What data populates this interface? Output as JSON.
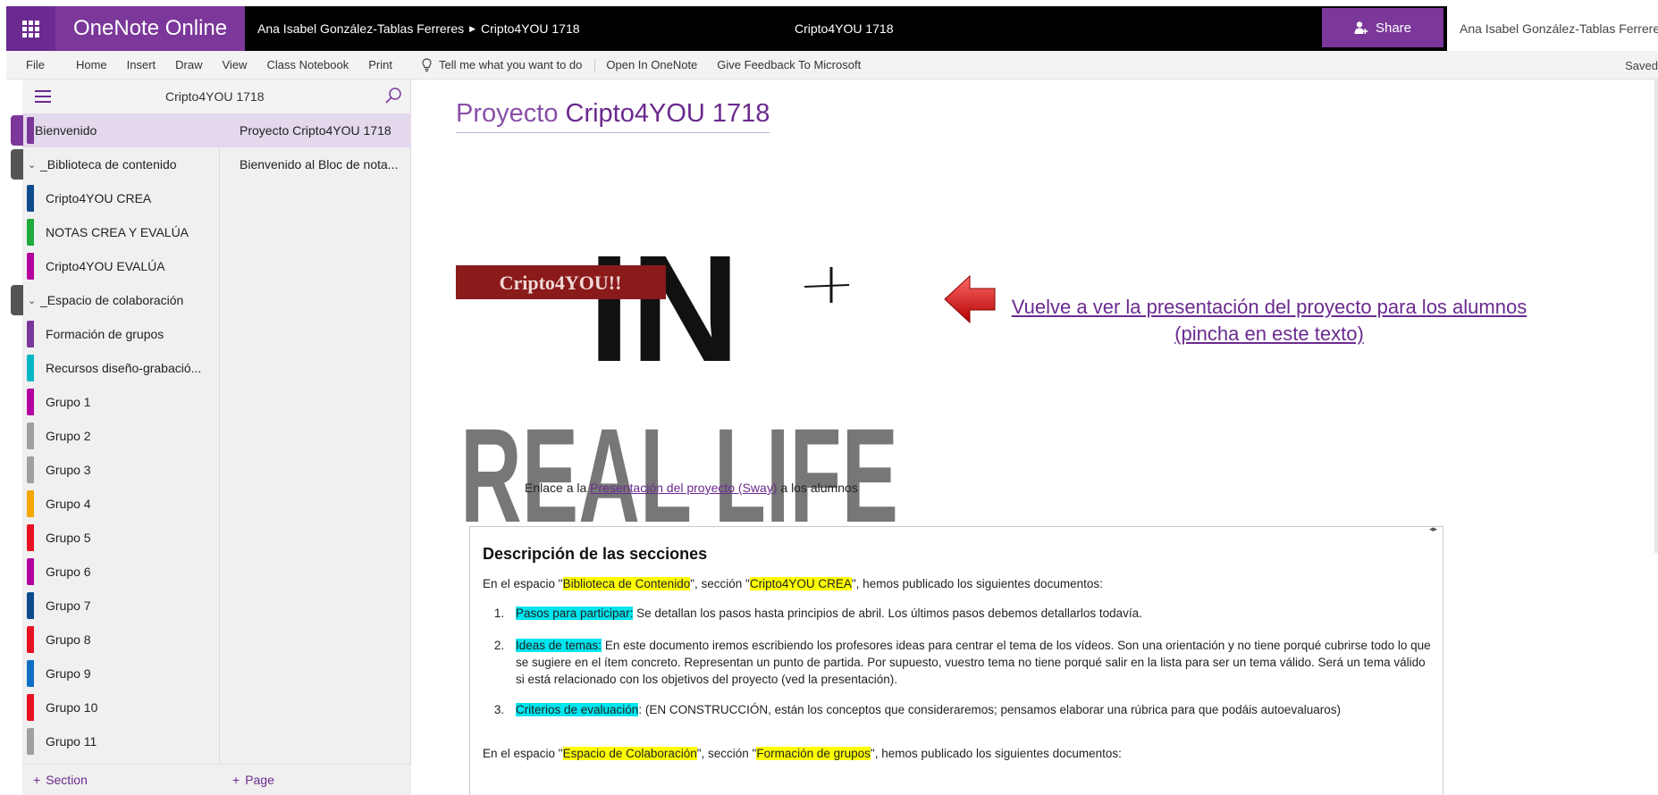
{
  "app": {
    "brand": "OneNote Online",
    "breadcrumb_owner": "Ana Isabel González-Tablas Ferreres",
    "breadcrumb_notebook": "Cripto4YOU 1718",
    "center_title": "Cripto4YOU 1718",
    "share_label": "Share",
    "user_name": "Ana Isabel González-Tablas Ferreres",
    "saved_status": "Saved"
  },
  "menu": {
    "items": [
      "File",
      "Home",
      "Insert",
      "Draw",
      "View",
      "Class Notebook",
      "Print"
    ],
    "tell_me": "Tell me what you want to do",
    "open_in_onenote": "Open In OneNote",
    "feedback": "Give Feedback To Microsoft"
  },
  "nav": {
    "notebook_title": "Cripto4YOU 1718",
    "sections": [
      {
        "label": "Bienvenido",
        "color": "#7b3799",
        "type": "section",
        "selected": true
      },
      {
        "label": "_Biblioteca de contenido",
        "color": "#555555",
        "type": "group"
      },
      {
        "label": "Cripto4YOU CREA",
        "color": "#0e4b8c",
        "type": "section"
      },
      {
        "label": "NOTAS CREA Y EVALÚA",
        "color": "#1faa3c",
        "type": "section"
      },
      {
        "label": "Cripto4YOU EVALÚA",
        "color": "#b4009e",
        "type": "section"
      },
      {
        "label": "_Espacio de colaboración",
        "color": "#555555",
        "type": "group"
      },
      {
        "label": "Formación de grupos",
        "color": "#7b3799",
        "type": "section"
      },
      {
        "label": "Recursos diseño-grabació...",
        "color": "#00b7c3",
        "type": "section"
      },
      {
        "label": "Grupo 1",
        "color": "#b4009e",
        "type": "section"
      },
      {
        "label": "Grupo 2",
        "color": "#a0a0a0",
        "type": "section"
      },
      {
        "label": "Grupo 3",
        "color": "#a0a0a0",
        "type": "section"
      },
      {
        "label": "Grupo 4",
        "color": "#f2a800",
        "type": "section"
      },
      {
        "label": "Grupo 5",
        "color": "#e81123",
        "type": "section"
      },
      {
        "label": "Grupo 6",
        "color": "#b4009e",
        "type": "section"
      },
      {
        "label": "Grupo 7",
        "color": "#0e4b8c",
        "type": "section"
      },
      {
        "label": "Grupo 8",
        "color": "#e81123",
        "type": "section"
      },
      {
        "label": "Grupo 9",
        "color": "#0e6fc4",
        "type": "section"
      },
      {
        "label": "Grupo 10",
        "color": "#e81123",
        "type": "section"
      },
      {
        "label": "Grupo 11",
        "color": "#a0a0a0",
        "type": "section"
      }
    ],
    "pages": [
      {
        "label": "Proyecto Cripto4YOU 1718",
        "selected": true
      },
      {
        "label": "Bienvenido al Bloc de nota..."
      }
    ],
    "add_section": "Section",
    "add_page": "Page"
  },
  "page": {
    "title_prefix": "Proyecto",
    "title_main": "Cripto4YOU 1718",
    "logo_tag": "Cripto4YOU!!",
    "logo_line1": "IN",
    "logo_line2": "REAL LIFE",
    "video_link": "Vuelve a ver la presentación del proyecto para los alumnos (pincha en este texto)",
    "sway_prefix": "Enlace a la",
    "sway_link": "Presentación del proyecto (Sway)",
    "sway_suffix": "a los alumnos",
    "desc": {
      "title": "Descripción de las secciones",
      "p1_a": "En el espacio \"",
      "p1_hl1": "Biblioteca de Contenido",
      "p1_b": "\", sección \"",
      "p1_hl2": "Cripto4YOU CREA",
      "p1_c": "\", hemos publicado los siguientes documentos:",
      "items": [
        {
          "num": "1.",
          "hl": "Pasos para participar:",
          "text": " Se detallan los pasos hasta principios de abril. Los últimos pasos debemos detallarlos todavía."
        },
        {
          "num": "2.",
          "hl": "Ideas de temas:",
          "text": " En este documento iremos escribiendo los profesores ideas para centrar el tema de los vídeos. Son una orientación y no tiene porqué cubrirse todo lo que se sugiere en el ítem concreto. Representan un punto de partida. Por supuesto, vuestro tema no tiene porqué salir en la lista para ser un tema válido. Será un tema válido si está relacionado con los objetivos del proyecto (ved la presentación)."
        },
        {
          "num": "3.",
          "hl": "Criterios de evaluación",
          "text": ": (EN CONSTRUCCIÓN, están los conceptos que consideraremos; pensamos elaborar una rúbrica para que podáis autoevaluaros)"
        }
      ],
      "p2_a": "En el espacio \"",
      "p2_hl1": "Espacio de Colaboración",
      "p2_b": "\", sección \"",
      "p2_hl2": "Formación de grupos",
      "p2_c": "\", hemos publicado los siguientes documentos:"
    }
  }
}
